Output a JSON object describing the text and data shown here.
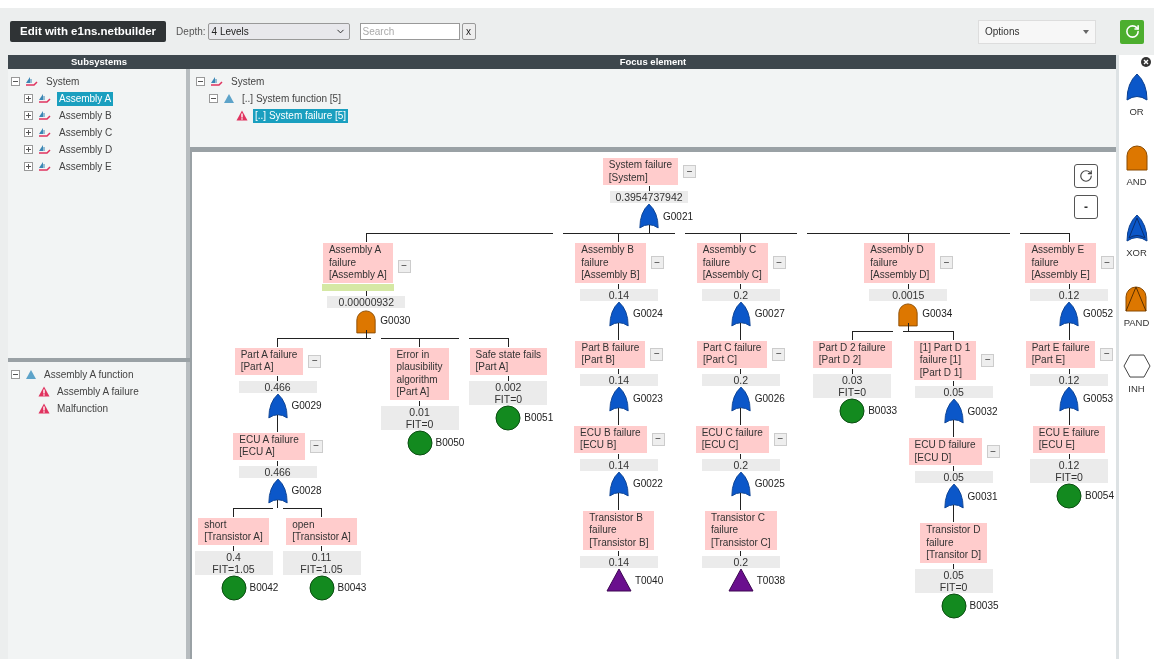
{
  "toolbar": {
    "edit_button": "Edit with e1ns.netbuilder",
    "depth_label": "Depth:",
    "depth_value": "4 Levels",
    "search": {
      "placeholder": "Search"
    },
    "clear_button": "x",
    "options_value": "Options"
  },
  "subsystems": {
    "title": "Subsystems",
    "tree": [
      {
        "label": "System",
        "kind": "system",
        "expanded": true,
        "selected": false,
        "children": [
          {
            "label": "Assembly A",
            "kind": "system",
            "expanded": false,
            "selected": true
          },
          {
            "label": "Assembly B",
            "kind": "system",
            "expanded": false,
            "selected": false
          },
          {
            "label": "Assembly C",
            "kind": "system",
            "expanded": false,
            "selected": false
          },
          {
            "label": "Assembly D",
            "kind": "system",
            "expanded": false,
            "selected": false
          },
          {
            "label": "Assembly E",
            "kind": "system",
            "expanded": false,
            "selected": false
          }
        ]
      }
    ]
  },
  "functions": {
    "tree": [
      {
        "label": "Assembly A function",
        "kind": "function",
        "expanded": true,
        "selected": false,
        "children": [
          {
            "label": "Assembly A failure",
            "kind": "failure",
            "selected": false
          },
          {
            "label": "Malfunction",
            "kind": "failure",
            "selected": false
          }
        ]
      }
    ]
  },
  "focus": {
    "title": "Focus element",
    "tree": [
      {
        "label": "System",
        "kind": "system",
        "expanded": true,
        "selected": false,
        "children": [
          {
            "label": "[..] System function [5]",
            "kind": "function",
            "expanded": true,
            "selected": false,
            "children": [
              {
                "label": "[..] System failure [5]",
                "kind": "failure",
                "selected": true
              }
            ]
          }
        ]
      }
    ]
  },
  "diagram": {
    "zoom_out_button": "-",
    "root": {
      "label": "System failure\n[System]",
      "toggle": "−",
      "value": "0.3954737942",
      "symbol": {
        "kind": "or",
        "id": "G0021"
      },
      "children": [
        {
          "label": "Assembly A\nfailure\n[Assembly A]",
          "toggle": "−",
          "marked": true,
          "value": "0.00000932",
          "symbol": {
            "kind": "and",
            "id": "G0030"
          },
          "children": [
            {
              "label": "Part A failure\n[Part A]",
              "toggle": "−",
              "value": "0.466",
              "symbol": {
                "kind": "or",
                "id": "G0029"
              },
              "children": [
                {
                  "label": "ECU A failure\n[ECU A]",
                  "toggle": "−",
                  "value": "0.466",
                  "symbol": {
                    "kind": "or",
                    "id": "G0028"
                  },
                  "children": [
                    {
                      "label": "short\n[Transistor A]",
                      "value": "0.4",
                      "fit": "FIT=1.05",
                      "symbol": {
                        "kind": "basic",
                        "id": "B0042"
                      }
                    },
                    {
                      "label": "open\n[Transistor A]",
                      "value": "0.11",
                      "fit": "FIT=1.05",
                      "symbol": {
                        "kind": "basic",
                        "id": "B0043"
                      }
                    }
                  ]
                }
              ]
            },
            {
              "label": "Error in\nplausibility\nalgorithm\n[Part A]",
              "value": "0.01",
              "fit": "FIT=0",
              "symbol": {
                "kind": "basic",
                "id": "B0050"
              }
            },
            {
              "label": "Safe state fails\n[Part A]",
              "value": "0.002",
              "fit": "FIT=0",
              "symbol": {
                "kind": "basic",
                "id": "B0051"
              }
            }
          ]
        },
        {
          "label": "Assembly B\nfailure\n[Assembly B]",
          "toggle": "−",
          "value": "0.14",
          "symbol": {
            "kind": "or",
            "id": "G0024"
          },
          "children": [
            {
              "label": "Part B failure\n[Part B]",
              "toggle": "−",
              "value": "0.14",
              "symbol": {
                "kind": "or",
                "id": "G0023"
              },
              "children": [
                {
                  "label": "ECU B failure\n[ECU B]",
                  "toggle": "−",
                  "value": "0.14",
                  "symbol": {
                    "kind": "or",
                    "id": "G0022"
                  },
                  "children": [
                    {
                      "label": "Transistor B\nfailure\n[Transistor B]",
                      "value": "0.14",
                      "symbol": {
                        "kind": "transfer",
                        "id": "T0040"
                      }
                    }
                  ]
                }
              ]
            }
          ]
        },
        {
          "label": "Assembly C\nfailure\n[Assembly C]",
          "toggle": "−",
          "value": "0.2",
          "symbol": {
            "kind": "or",
            "id": "G0027"
          },
          "children": [
            {
              "label": "Part C failure\n[Part C]",
              "toggle": "−",
              "value": "0.2",
              "symbol": {
                "kind": "or",
                "id": "G0026"
              },
              "children": [
                {
                  "label": "ECU C failure\n[ECU C]",
                  "toggle": "−",
                  "value": "0.2",
                  "symbol": {
                    "kind": "or",
                    "id": "G0025"
                  },
                  "children": [
                    {
                      "label": "Transistor C\nfailure\n[Transistor C]",
                      "value": "0.2",
                      "symbol": {
                        "kind": "transfer",
                        "id": "T0038"
                      }
                    }
                  ]
                }
              ]
            }
          ]
        },
        {
          "label": "Assembly D\nfailure\n[Assembly D]",
          "toggle": "−",
          "value": "0.0015",
          "symbol": {
            "kind": "and",
            "id": "G0034"
          },
          "children": [
            {
              "label": "Part D 2 failure\n[Part D 2]",
              "value": "0.03",
              "fit": "FIT=0",
              "symbol": {
                "kind": "basic",
                "id": "B0033"
              }
            },
            {
              "label": "[1] Part D 1\nfailure [1]\n[Part D 1]",
              "toggle": "−",
              "value": "0.05",
              "symbol": {
                "kind": "or",
                "id": "G0032"
              },
              "children": [
                {
                  "label": "ECU D failure\n[ECU D]",
                  "toggle": "−",
                  "value": "0.05",
                  "symbol": {
                    "kind": "or",
                    "id": "G0031"
                  },
                  "children": [
                    {
                      "label": "Transistor D\nfailure\n[Transitor D]",
                      "value": "0.05",
                      "fit": "FIT=0",
                      "symbol": {
                        "kind": "basic",
                        "id": "B0035"
                      }
                    }
                  ]
                }
              ]
            }
          ]
        },
        {
          "label": "Assembly E\nfailure\n[Assembly E]",
          "toggle": "−",
          "value": "0.12",
          "symbol": {
            "kind": "or",
            "id": "G0052"
          },
          "children": [
            {
              "label": "Part E failure\n[Part E]",
              "toggle": "−",
              "value": "0.12",
              "symbol": {
                "kind": "or",
                "id": "G0053"
              },
              "children": [
                {
                  "label": "ECU E failure\n[ECU E]",
                  "value": "0.12",
                  "fit": "FIT=0",
                  "symbol": {
                    "kind": "basic",
                    "id": "B0054"
                  }
                }
              ]
            }
          ]
        }
      ]
    }
  },
  "palette": [
    {
      "kind": "or",
      "label": "OR"
    },
    {
      "kind": "and",
      "label": "AND"
    },
    {
      "kind": "xor",
      "label": "XOR"
    },
    {
      "kind": "pand",
      "label": "PAND"
    },
    {
      "kind": "inh",
      "label": "INH"
    }
  ]
}
